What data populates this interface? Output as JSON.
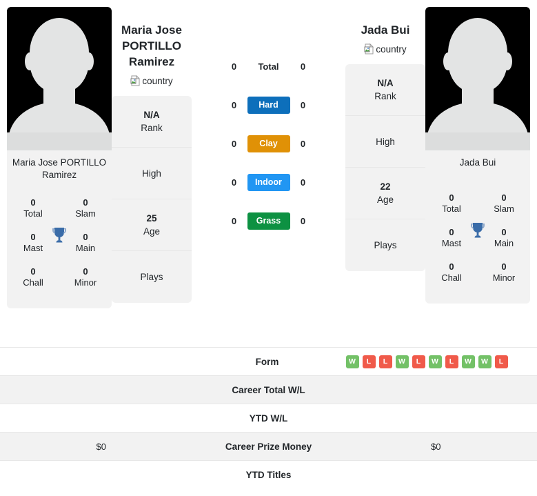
{
  "players": {
    "left": {
      "card_name": "Maria Jose PORTILLO Ramirez",
      "display_name": "Maria Jose PORTILLO Ramirez",
      "country_alt": "country",
      "rank": "N/A",
      "rank_label": "Rank",
      "high_label": "High",
      "high_value": "",
      "age": "25",
      "age_label": "Age",
      "plays_label": "Plays",
      "plays_value": "",
      "titles": [
        {
          "value": "0",
          "label": "Total"
        },
        {
          "value": "0",
          "label": "Slam"
        },
        {
          "value": "0",
          "label": "Mast"
        },
        {
          "value": "0",
          "label": "Main"
        },
        {
          "value": "0",
          "label": "Chall"
        },
        {
          "value": "0",
          "label": "Minor"
        }
      ]
    },
    "right": {
      "card_name": "Jada Bui",
      "display_name": "Jada Bui",
      "country_alt": "country",
      "rank": "N/A",
      "rank_label": "Rank",
      "high_label": "High",
      "high_value": "",
      "age": "22",
      "age_label": "Age",
      "plays_label": "Plays",
      "plays_value": "",
      "titles": [
        {
          "value": "0",
          "label": "Total"
        },
        {
          "value": "0",
          "label": "Slam"
        },
        {
          "value": "0",
          "label": "Mast"
        },
        {
          "value": "0",
          "label": "Main"
        },
        {
          "value": "0",
          "label": "Chall"
        },
        {
          "value": "0",
          "label": "Minor"
        }
      ]
    }
  },
  "surfaces": [
    {
      "label": "Total",
      "left": "0",
      "right": "0",
      "color": "",
      "badge": false
    },
    {
      "label": "Hard",
      "left": "0",
      "right": "0",
      "color": "#0d6fbb",
      "badge": true
    },
    {
      "label": "Clay",
      "left": "0",
      "right": "0",
      "color": "#e09106",
      "badge": true
    },
    {
      "label": "Indoor",
      "left": "0",
      "right": "0",
      "color": "#2196f3",
      "badge": true
    },
    {
      "label": "Grass",
      "left": "0",
      "right": "0",
      "color": "#0d9142",
      "badge": true
    }
  ],
  "rows": [
    {
      "label": "Form",
      "left": "",
      "right": ""
    },
    {
      "label": "Career Total W/L",
      "left": "",
      "right": ""
    },
    {
      "label": "YTD W/L",
      "left": "",
      "right": ""
    },
    {
      "label": "Career Prize Money",
      "left": "$0",
      "right": "$0"
    },
    {
      "label": "YTD Titles",
      "left": "",
      "right": ""
    }
  ],
  "form": [
    "W",
    "L",
    "L",
    "W",
    "L",
    "W",
    "L",
    "W",
    "W",
    "L"
  ],
  "colors": {
    "win": "#73c167",
    "loss": "#f05a4a",
    "trophy": "#3a6ca8",
    "panel": "#f2f2f2"
  }
}
